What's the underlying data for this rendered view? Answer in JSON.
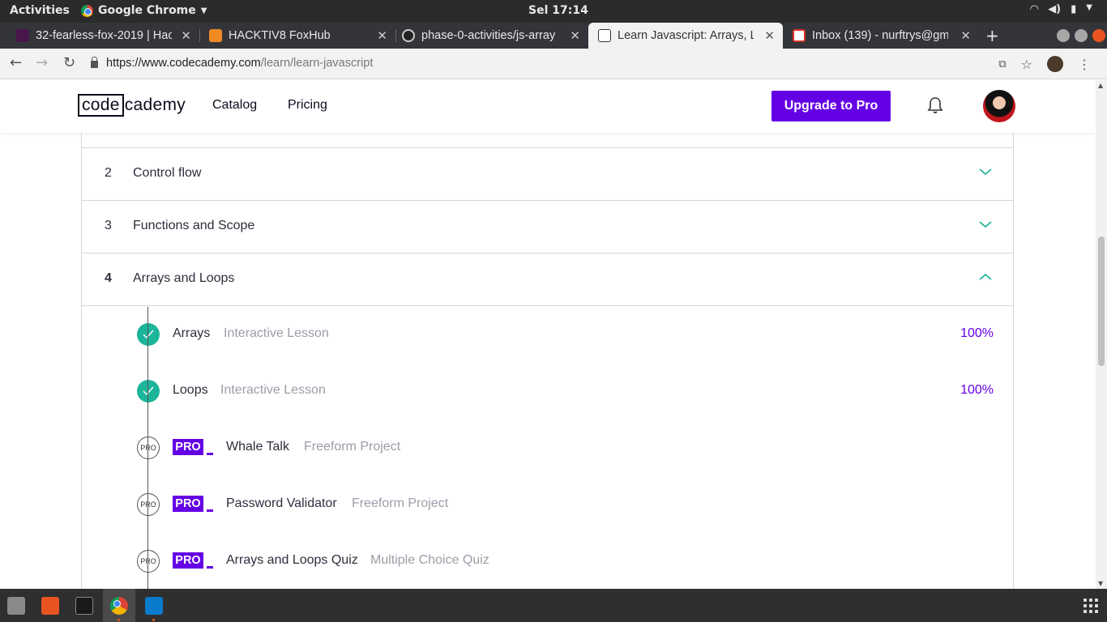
{
  "os_bar": {
    "activities": "Activities",
    "app_name": "Google Chrome",
    "clock": "Sel 17:14"
  },
  "tabs": [
    {
      "title": "32-fearless-fox-2019 | Hac",
      "favicon_color": "#4a154b"
    },
    {
      "title": "HACKTIV8 FoxHub",
      "favicon_color": "#f08a24"
    },
    {
      "title": "phase-0-activities/js-array",
      "favicon_color": "#222222"
    },
    {
      "title": "Learn Javascript: Arrays, L",
      "favicon_color": "#ffffff",
      "active": true
    },
    {
      "title": "Inbox (139) - nurftrys@gm",
      "favicon_color": "#d93025"
    }
  ],
  "address": {
    "host": "https://www.codecademy.com",
    "path": "/learn/learn-javascript"
  },
  "header": {
    "logo_part1": "code",
    "logo_part2": "cademy",
    "nav": [
      "Catalog",
      "Pricing"
    ],
    "upgrade_label": "Upgrade to Pro"
  },
  "modules": [
    {
      "num": "2",
      "name": "Control flow",
      "state": "collapsed"
    },
    {
      "num": "3",
      "name": "Functions and Scope",
      "state": "collapsed"
    },
    {
      "num": "4",
      "name": "Arrays and Loops",
      "state": "expanded"
    }
  ],
  "lessons": [
    {
      "name": "Arrays",
      "type": "Interactive Lesson",
      "progress": "100%",
      "completed": true,
      "pro": false
    },
    {
      "name": "Loops",
      "type": "Interactive Lesson",
      "progress": "100%",
      "completed": true,
      "pro": false
    },
    {
      "name": "Whale Talk",
      "type": "Freeform Project",
      "completed": false,
      "pro": true
    },
    {
      "name": "Password Validator",
      "type": "Freeform Project",
      "completed": false,
      "pro": true
    },
    {
      "name": "Arrays and Loops Quiz",
      "type": "Multiple Choice Quiz",
      "completed": false,
      "pro": true
    }
  ],
  "labels": {
    "pro_badge": "PRO",
    "pro_circle": "PRO"
  },
  "colors": {
    "accent_purple": "#6400e4",
    "check_green": "#1bb59a",
    "chevron_teal": "#1bb59a"
  }
}
